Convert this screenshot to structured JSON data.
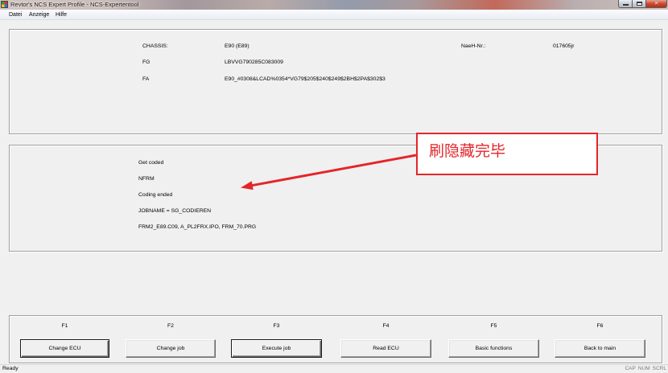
{
  "window": {
    "title": "Revtor's NCS Expert Profile - NCS-Expertentool",
    "icons": {
      "app": "ncs-app-icon",
      "minimize": "minimize-icon",
      "maximize": "maximize-icon",
      "close": "close-icon"
    }
  },
  "menu": [
    "Datei",
    "Anzeige",
    "Hilfe"
  ],
  "vehicle": {
    "chassis": {
      "label": "CHASSIS:",
      "value": "E90 (E89)"
    },
    "fg": {
      "label": "FG",
      "value": "LBVVG790285C083009"
    },
    "fa": {
      "label": "FA",
      "value": "E90_#0308&LCAD%0354*VG79$205$240$249$2BH$2PA$302$3"
    },
    "naeh": {
      "label": "NaeH-Nr.:",
      "value": "017605jr"
    }
  },
  "log": [
    "Get coded",
    "NFRM",
    "Coding ended",
    "JOBNAME = SG_CODIEREN",
    "FRM2_E89.C09, A_PL2FRX.IPO, FRM_70.PRG"
  ],
  "annotation": {
    "text": "刷隐藏完毕"
  },
  "function_keys": [
    {
      "key": "F1",
      "button": "Change ECU"
    },
    {
      "key": "F2",
      "button": "Change job"
    },
    {
      "key": "F3",
      "button": "Execute job"
    },
    {
      "key": "F4",
      "button": "Read ECU"
    },
    {
      "key": "F5",
      "button": "Basic functions"
    },
    {
      "key": "F6",
      "button": "Back to main"
    }
  ],
  "status": {
    "text": "Ready",
    "indicators": [
      "CAP",
      "NUM",
      "SCRL"
    ]
  },
  "colors": {
    "annotation": "#e3262b",
    "close_button": "#cf4a30",
    "window_background": "#f0f0f0"
  }
}
